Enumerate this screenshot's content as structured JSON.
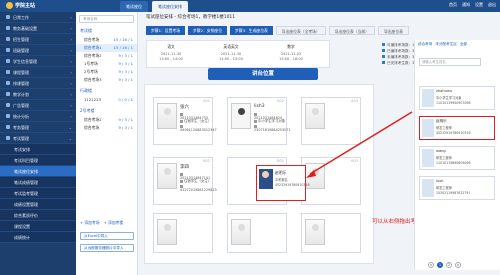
{
  "app": {
    "title": "学院主站"
  },
  "tabs": [
    {
      "label": "笔试座位"
    },
    {
      "label": "笔试座位安排"
    }
  ],
  "topbar_right": [
    "首页",
    "通知",
    "设置",
    "退出"
  ],
  "sidebar": {
    "items": [
      {
        "label": "日常工作"
      },
      {
        "label": "教务基础设置"
      },
      {
        "label": "招生管理"
      },
      {
        "label": "班级管理"
      },
      {
        "label": "学生信息管理"
      },
      {
        "label": "课程管理"
      },
      {
        "label": "排课管理"
      },
      {
        "label": "教学计划"
      },
      {
        "label": "广告管理"
      },
      {
        "label": "统计分析"
      },
      {
        "label": "考务管理"
      },
      {
        "label": "考试管理"
      }
    ],
    "subitems": [
      {
        "label": "考试安排"
      },
      {
        "label": "考试科目管理"
      },
      {
        "label": "笔试座位安排",
        "active": true
      },
      {
        "label": "笔试成绩管理"
      },
      {
        "label": "考试监考管理"
      },
      {
        "label": "成绩设置管理"
      },
      {
        "label": "综合素质评价"
      },
      {
        "label": "课程设置"
      },
      {
        "label": "成绩统计"
      }
    ]
  },
  "examlist": {
    "search_placeholder": "考场名称",
    "groups": [
      {
        "title": "考试楼",
        "rows": [
          {
            "name": "综合考场",
            "count": "15 / 16 / 1"
          },
          {
            "name": "综合考场1",
            "count": "15 / 16 / 1"
          },
          {
            "name": "综合考场2",
            "count": "9 / 3 / 1"
          },
          {
            "name": "1号考场",
            "count": "9 / 3 / 1"
          },
          {
            "name": "2号考场",
            "count": "9 / 3 / 1"
          },
          {
            "name": "综合考场3",
            "count": "9 / 3 / 1"
          }
        ]
      },
      {
        "title": "行政楼",
        "rows": [
          {
            "name": "1121223",
            "count": "0 / 0 / 1"
          }
        ]
      },
      {
        "title": "2号考楼",
        "rows": [
          {
            "name": "综合考场2",
            "count": "9 / 3 / 1"
          },
          {
            "name": "综合考场",
            "count": "9 / 3 / 1"
          }
        ]
      }
    ],
    "add_room": "+ 添加考场",
    "add_building": "+ 添加考楼",
    "import_students": "从Excel中导入",
    "import_photos": "从远程服务器照片中导入"
  },
  "main": {
    "breadcrumb": "笔试座位安排 - 综合考场1，教学楼1楼1011",
    "steps": [
      {
        "label": "步骤1：设置考场",
        "active": true
      },
      {
        "label": "步骤2：安排座位",
        "active": true
      },
      {
        "label": "步骤3：生成座位表",
        "active": true
      },
      {
        "label": "导出座位表（全考场）"
      },
      {
        "label": "导出座位表（当前）"
      },
      {
        "label": "导出座位表"
      }
    ],
    "info": {
      "cols": [
        {
          "label": "语文",
          "value": "2021-11-30\n13:00 - 14:00"
        },
        {
          "label": "英语英文",
          "value": "2021-11-30\n14:00 - 15:00"
        },
        {
          "label": "数学",
          "value": "2021-12-02\n15:00 - 18:00"
        }
      ]
    },
    "stats": [
      "可编排考场数：16 人",
      "已编排考场数：3 人",
      "未编排考场数：3 人",
      "已安排考生数：3 人"
    ],
    "banner": "讲台位置",
    "hint": "可以从右侧拖出考生区拖拽考生到座位"
  },
  "seats": [
    {
      "num": "A01",
      "name": "张六",
      "id": "2021031484753",
      "state": "住宿学生（女生）",
      "phone": "44061120883012347",
      "filled": true
    },
    {
      "num": "A02",
      "name": "lish3",
      "id": "2021031484824",
      "state": "中小学生学习对象",
      "phone": "23071619884253071",
      "filled": true
    },
    {
      "num": "A03",
      "name": "",
      "filled": false
    },
    {
      "num": "B01",
      "name": "李四",
      "id": "20210314847141",
      "state": "住宿学生（女生）",
      "phone": "41272019861229823",
      "filled": true
    },
    {
      "num": "B02",
      "name": "",
      "filled": false
    },
    {
      "num": "B03",
      "name": "",
      "filled": false
    }
  ],
  "highlight_seat": {
    "name": "赵明乐",
    "tag": "中考报名",
    "id": "45232919780910316"
  },
  "rpanel": {
    "tabs": [
      "综合考场",
      "未分配考生区",
      "全部"
    ],
    "search_placeholder": "请输入考生姓名",
    "cards": [
      {
        "name": "zhahuisu",
        "tag": "中小学生学习对象",
        "id": "11010119900907098",
        "selected": false
      },
      {
        "name": "赵明乐",
        "tag": "研发工程师",
        "id": "45232919780910316",
        "selected": true
      },
      {
        "name": "wang",
        "tag": "研发工程师",
        "id": "11010119890809098",
        "selected": false
      },
      {
        "name": "lush",
        "tag": "研发工程师",
        "id": "15302119987622791",
        "selected": false
      }
    ],
    "pager": [
      "<",
      "1",
      "2",
      ">"
    ]
  }
}
